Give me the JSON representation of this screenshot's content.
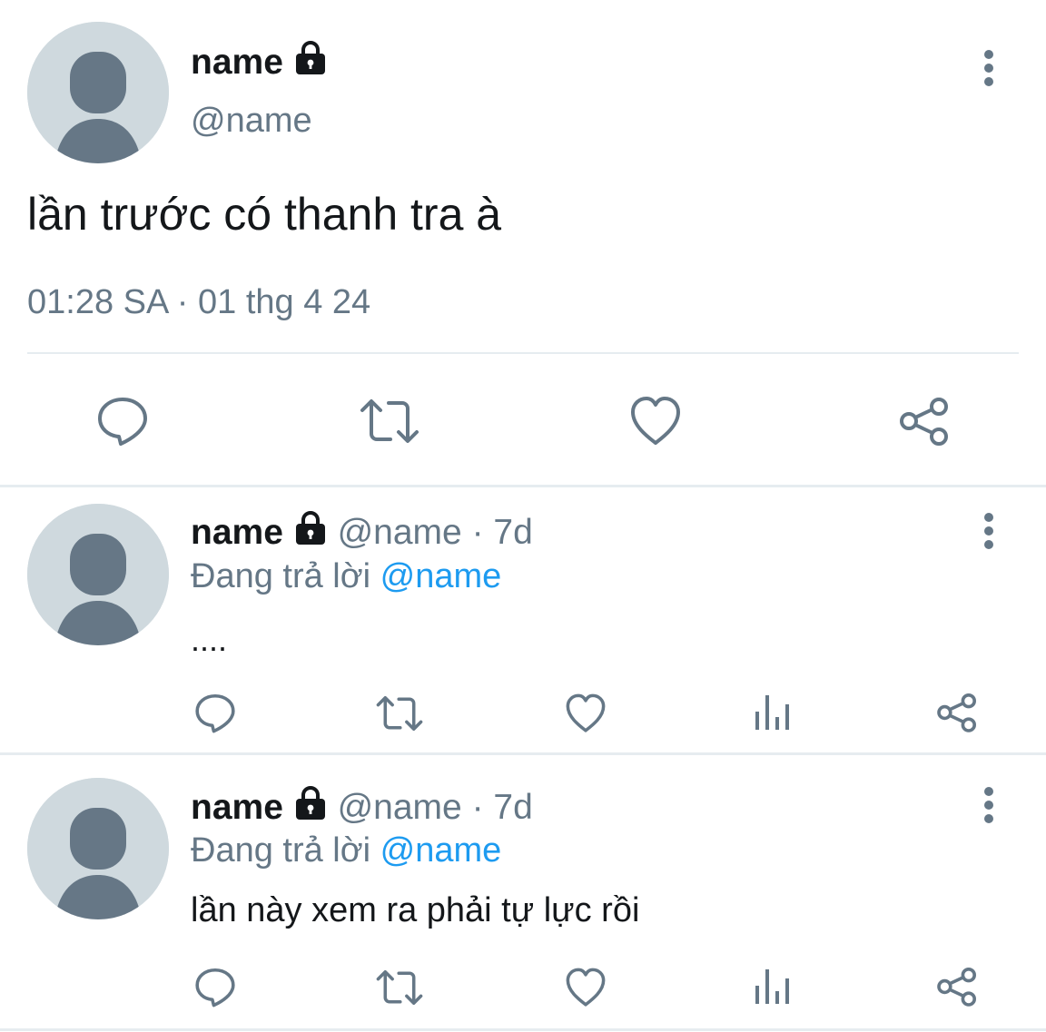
{
  "main_tweet": {
    "display_name": "name",
    "handle": "@name",
    "text": "lần trước có thanh tra à",
    "timestamp": "01:28 SA · 01 thg 4 24",
    "actions": [
      "reply-icon",
      "retweet-icon",
      "like-icon",
      "share-icon"
    ]
  },
  "replies": [
    {
      "display_name": "name",
      "handle": "@name",
      "age": "· 7d",
      "replying_prefix": "Đang trả lời",
      "replying_to": "@name",
      "text": "....",
      "actions": [
        "reply-icon",
        "retweet-icon",
        "like-icon",
        "analytics-icon",
        "share-icon"
      ]
    },
    {
      "display_name": "name",
      "handle": "@name",
      "age": "· 7d",
      "replying_prefix": "Đang trả lời",
      "replying_to": "@name",
      "text": "lần này xem ra phải tự lực rồi",
      "actions": [
        "reply-icon",
        "retweet-icon",
        "like-icon",
        "analytics-icon",
        "share-icon"
      ]
    }
  ],
  "colors": {
    "text": "#14171a",
    "secondary": "#657786",
    "link": "#1d9bf0",
    "avatar_bg": "#cfd9de",
    "avatar_fg": "#667786",
    "divider": "#e6ecf0"
  }
}
